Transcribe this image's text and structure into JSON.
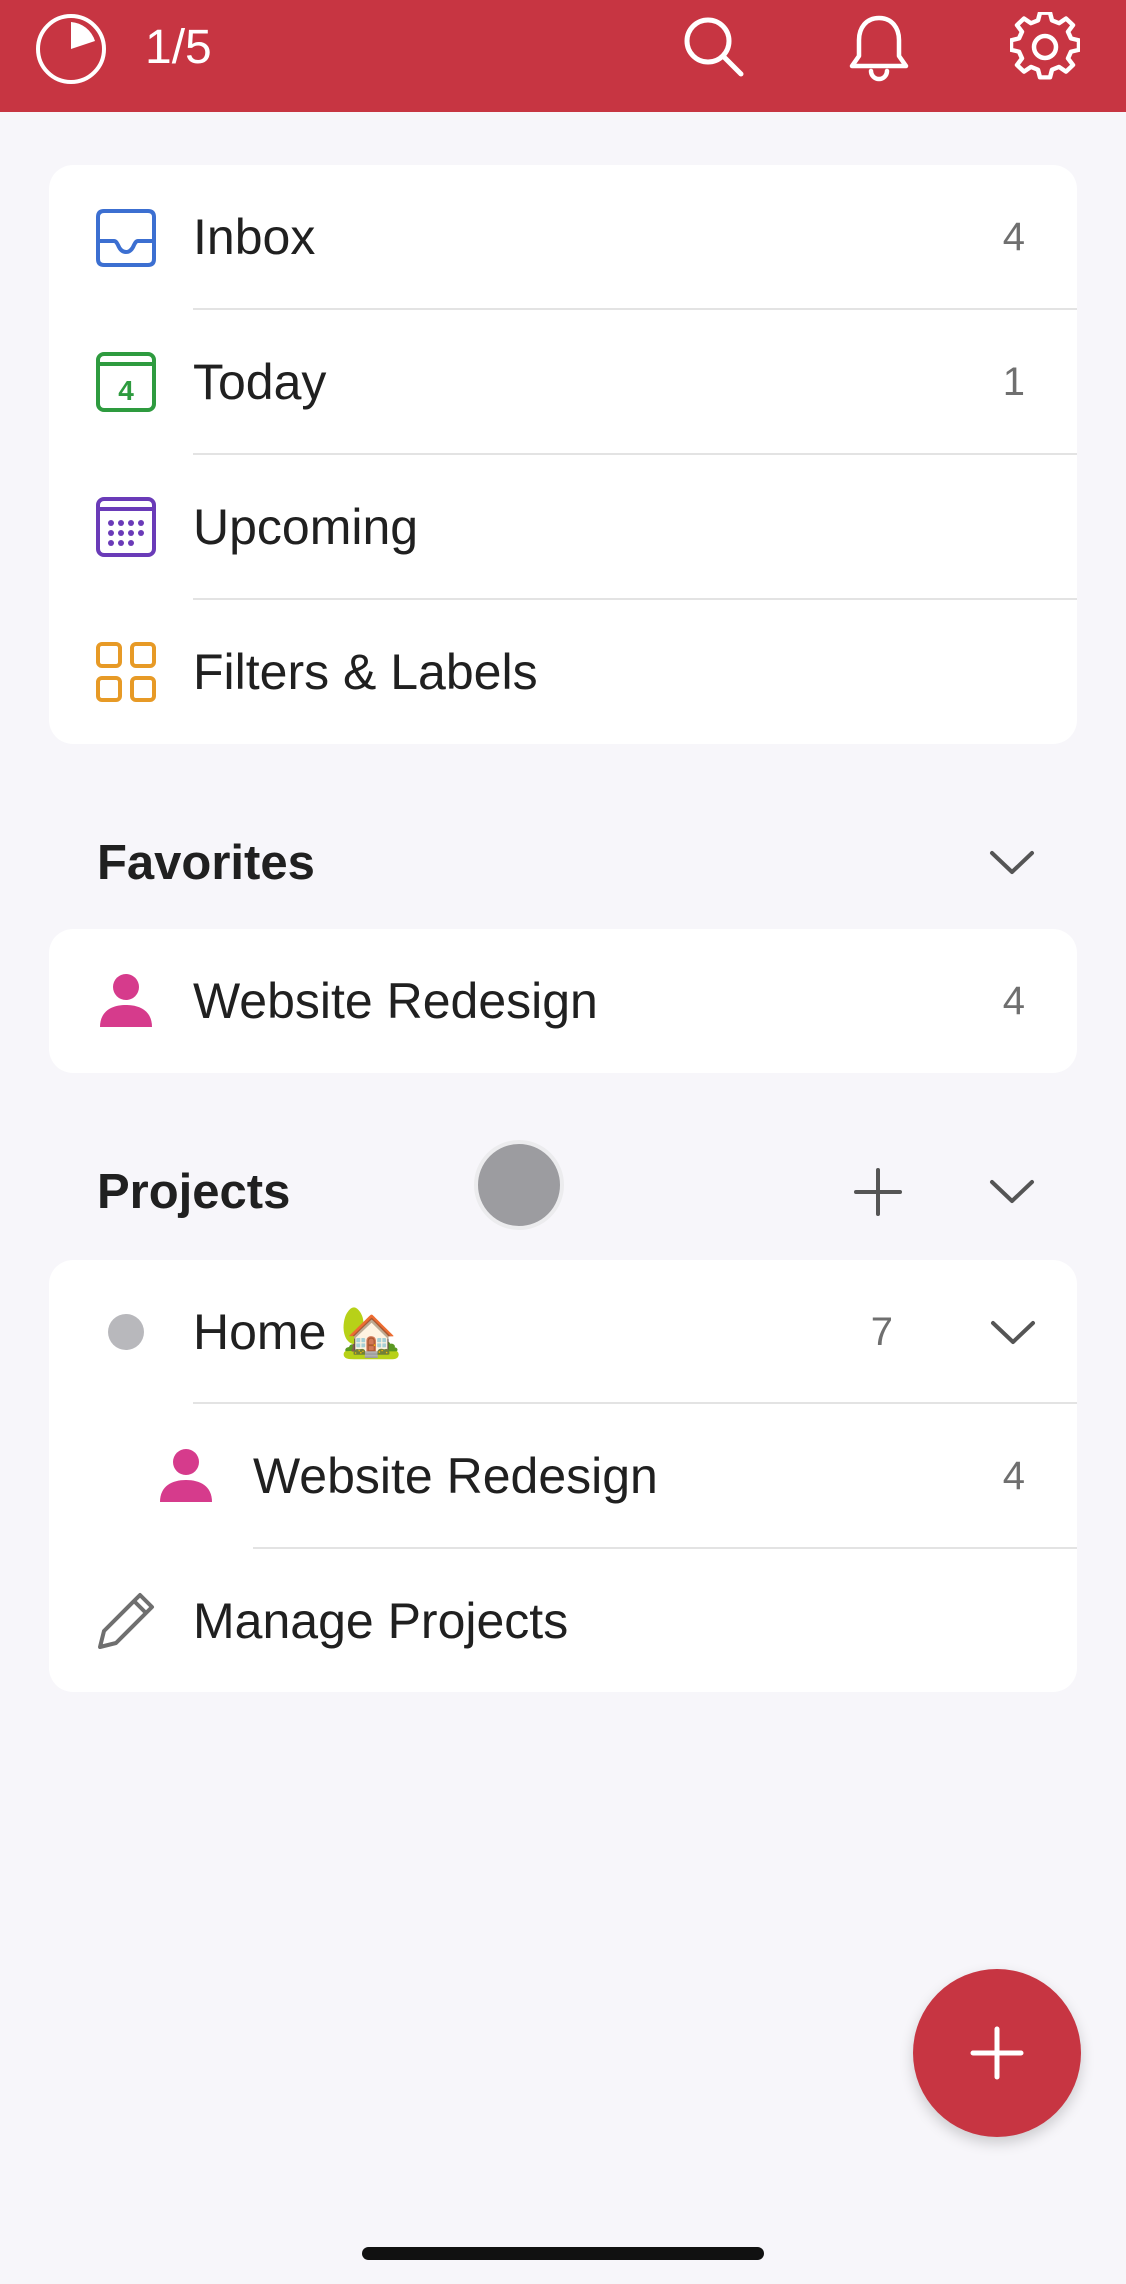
{
  "header": {
    "karma_text": "1/5",
    "icons": [
      "karma-pie-icon",
      "search-icon",
      "bell-icon",
      "gear-icon"
    ],
    "background": "#c73542"
  },
  "nav": {
    "items": [
      {
        "label": "Inbox",
        "count": "4",
        "icon": "inbox-icon",
        "color": "#3c6fd1"
      },
      {
        "label": "Today",
        "count": "1",
        "icon": "calendar-today-icon",
        "day": "4",
        "color": "#2e9b3f"
      },
      {
        "label": "Upcoming",
        "count": "",
        "icon": "calendar-upcoming-icon",
        "color": "#6a3bb8"
      },
      {
        "label": "Filters & Labels",
        "count": "",
        "icon": "filters-grid-icon",
        "color": "#e79a26"
      }
    ]
  },
  "favorites": {
    "title": "Favorites",
    "items": [
      {
        "label": "Website Redesign",
        "count": "4",
        "icon": "person-icon",
        "color": "#d63b8c"
      }
    ]
  },
  "projects": {
    "title": "Projects",
    "items": [
      {
        "label": "Home 🏡",
        "count": "7",
        "icon": "project-dot-icon",
        "color": "#b8b8bc"
      },
      {
        "label": "Website Redesign",
        "count": "4",
        "icon": "person-icon",
        "color": "#d63b8c"
      }
    ],
    "manage_label": "Manage Projects"
  },
  "fab": {
    "icon": "plus-icon",
    "color": "#c73542"
  }
}
